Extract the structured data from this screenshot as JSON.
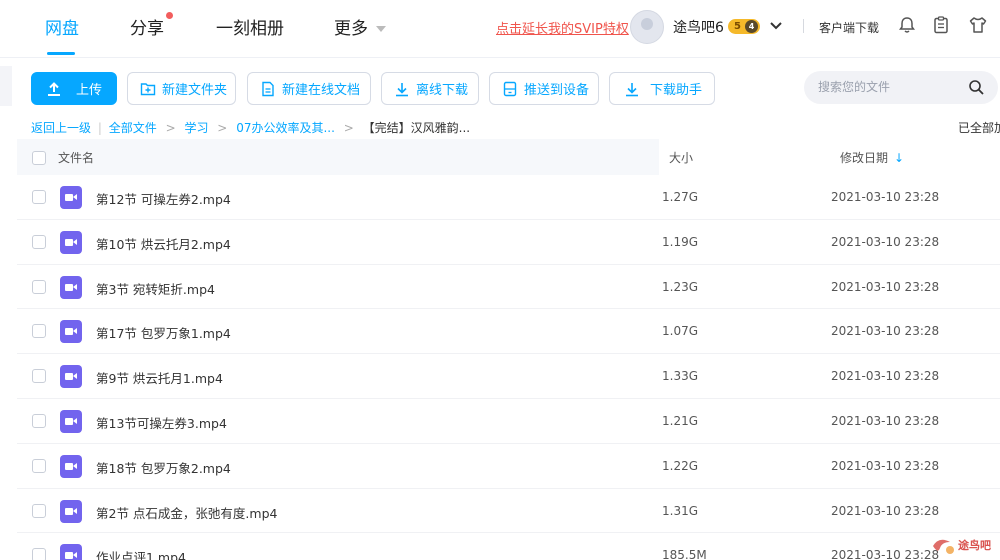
{
  "nav": {
    "items": [
      {
        "label": "网盘",
        "active": true
      },
      {
        "label": "分享",
        "active": false
      },
      {
        "label": "一刻相册",
        "active": false
      },
      {
        "label": "更多",
        "active": false
      }
    ],
    "svip_link": "点击延长我的SVIP特权",
    "username": "途鸟吧6",
    "vip_level": "5",
    "vip_sub": "4",
    "client_download": "客户端下载"
  },
  "toolbar": {
    "upload": "上传",
    "new_folder": "新建文件夹",
    "new_online_doc": "新建在线文档",
    "offline_download": "离线下载",
    "push_device": "推送到设备",
    "download_helper": "下载助手",
    "search_placeholder": "搜索您的文件"
  },
  "breadcrumb": {
    "back": "返回上一级",
    "items": [
      "全部文件",
      "学习",
      "07办公效率及其...",
      "【完结】汉风雅韵..."
    ],
    "loaded": "已全部加"
  },
  "table": {
    "headers": {
      "name": "文件名",
      "size": "大小",
      "date": "修改日期"
    },
    "rows": [
      {
        "name": "第12节 可操左券2.mp4",
        "size": "1.27G",
        "date": "2021-03-10 23:28"
      },
      {
        "name": "第10节 烘云托月2.mp4",
        "size": "1.19G",
        "date": "2021-03-10 23:28"
      },
      {
        "name": "第3节 宛转矩折.mp4",
        "size": "1.23G",
        "date": "2021-03-10 23:28"
      },
      {
        "name": "第17节 包罗万象1.mp4",
        "size": "1.07G",
        "date": "2021-03-10 23:28"
      },
      {
        "name": "第9节 烘云托月1.mp4",
        "size": "1.33G",
        "date": "2021-03-10 23:28"
      },
      {
        "name": "第13节可操左券3.mp4",
        "size": "1.21G",
        "date": "2021-03-10 23:28"
      },
      {
        "name": "第18节 包罗万象2.mp4",
        "size": "1.22G",
        "date": "2021-03-10 23:28"
      },
      {
        "name": "第2节 点石成金，张弛有度.mp4",
        "size": "1.31G",
        "date": "2021-03-10 23:28"
      },
      {
        "name": "作业点评1.mp4",
        "size": "185.5M",
        "date": "2021-03-10 23:28"
      }
    ]
  },
  "watermark": {
    "text": "途鸟吧"
  },
  "colors": {
    "accent": "#06a7ff",
    "video_icon": "#7264ee",
    "svip_red": "#f0544c"
  }
}
